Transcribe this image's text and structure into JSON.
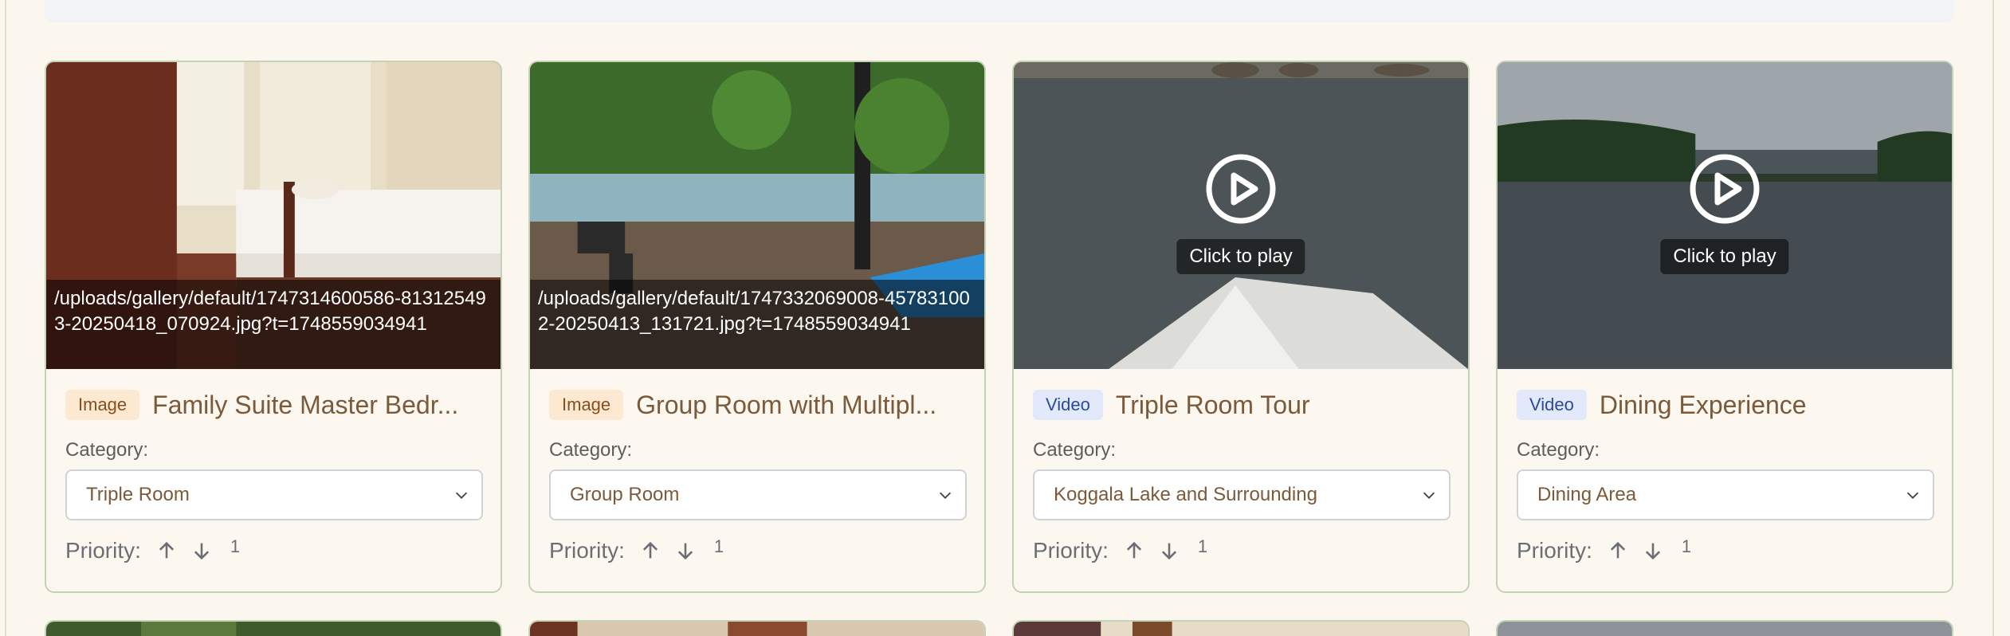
{
  "cards": [
    {
      "type_badge": "Image",
      "title": "Family Suite Master Bedr...",
      "path": "/uploads/gallery/default/1747314600586-813125493-20250418_070924.jpg?t=1748559034941",
      "category_label": "Category:",
      "category_value": "Triple Room",
      "priority_label": "Priority:",
      "priority_value": "1"
    },
    {
      "type_badge": "Image",
      "title": "Group Room with Multipl...",
      "path": "/uploads/gallery/default/1747332069008-457831002-20250413_131721.jpg?t=1748559034941",
      "category_label": "Category:",
      "category_value": "Group Room",
      "priority_label": "Priority:",
      "priority_value": "1"
    },
    {
      "type_badge": "Video",
      "title": "Triple Room Tour",
      "play_label": "Click to play",
      "category_label": "Category:",
      "category_value": "Koggala Lake and Surrounding",
      "priority_label": "Priority:",
      "priority_value": "1"
    },
    {
      "type_badge": "Video",
      "title": "Dining Experience",
      "play_label": "Click to play",
      "category_label": "Category:",
      "category_value": "Dining Area",
      "priority_label": "Priority:",
      "priority_value": "1"
    }
  ],
  "colors": {
    "page_bg": "#fbf6ee",
    "card_border": "#c4d3b6",
    "image_badge_bg": "#fde9d2",
    "video_badge_bg": "#e1e9fb"
  }
}
